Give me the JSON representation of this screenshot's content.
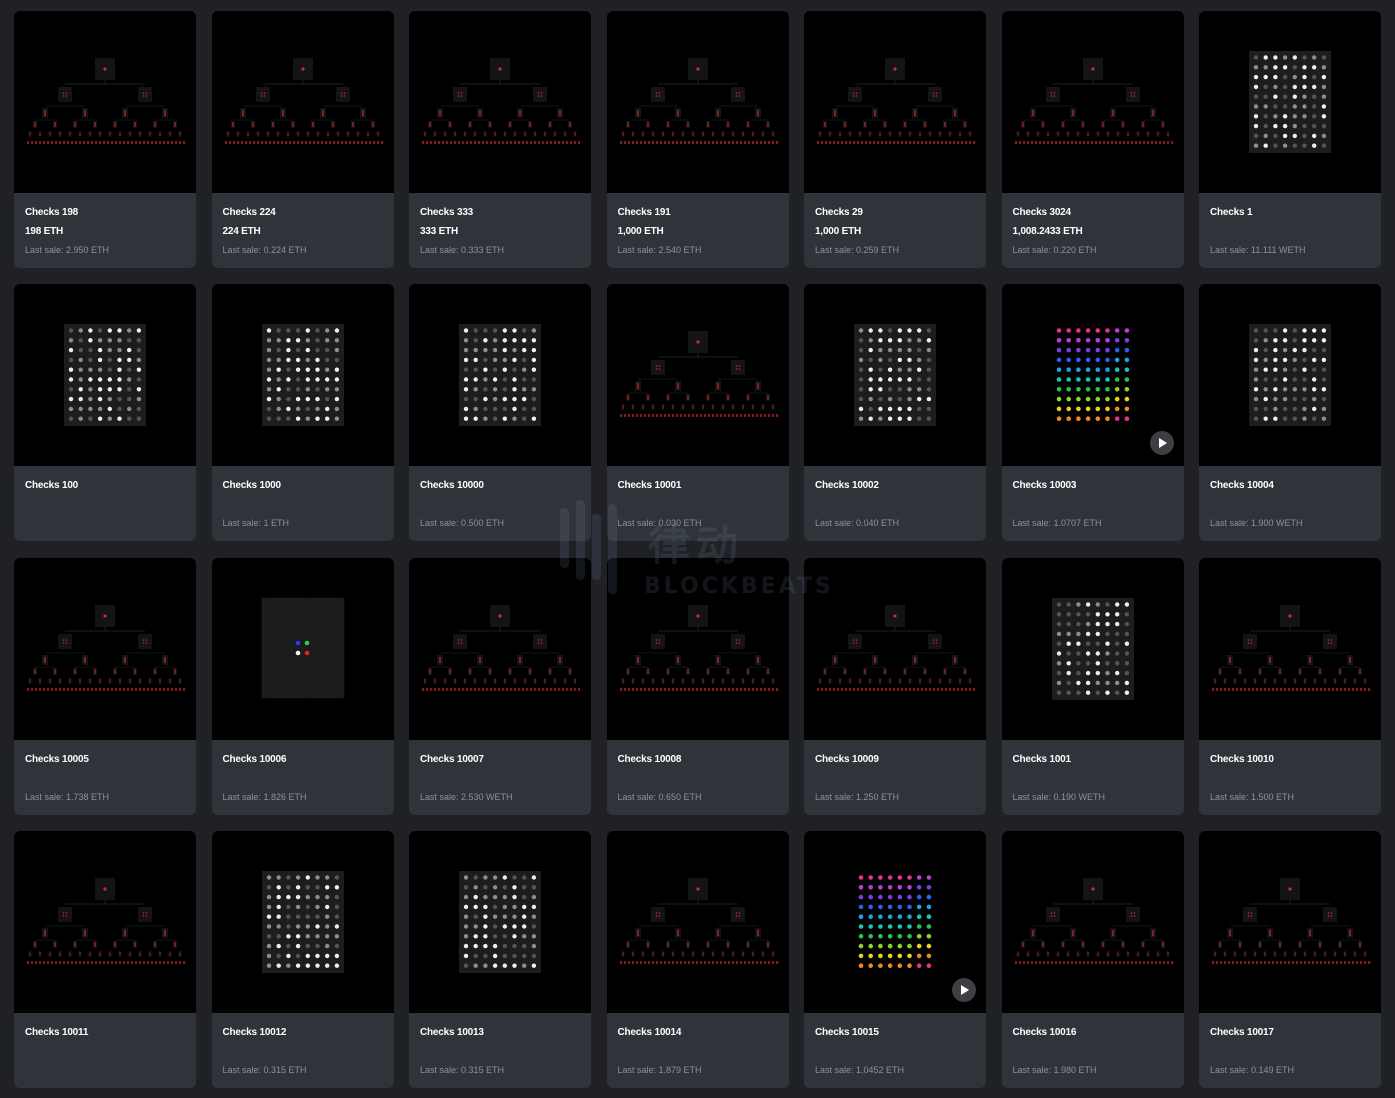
{
  "cards": [
    {
      "name": "Checks 198",
      "price": "198 ETH",
      "last_sale": "Last sale: 2.950 ETH",
      "art": "tree"
    },
    {
      "name": "Checks 224",
      "price": "224 ETH",
      "last_sale": "Last sale: 0.224 ETH",
      "art": "tree"
    },
    {
      "name": "Checks 333",
      "price": "333 ETH",
      "last_sale": "Last sale: 0.333 ETH",
      "art": "tree"
    },
    {
      "name": "Checks 191",
      "price": "1,000 ETH",
      "last_sale": "Last sale: 2.540 ETH",
      "art": "tree"
    },
    {
      "name": "Checks 29",
      "price": "1,000 ETH",
      "last_sale": "Last sale: 0.259 ETH",
      "art": "tree"
    },
    {
      "name": "Checks 3024",
      "price": "1,008.2433 ETH",
      "last_sale": "Last sale: 0.220 ETH",
      "art": "tree"
    },
    {
      "name": "Checks 1",
      "price": "",
      "last_sale": "Last sale: 11.111 WETH",
      "art": "grid"
    },
    {
      "name": "Checks 100",
      "price": "",
      "last_sale": "",
      "art": "grid"
    },
    {
      "name": "Checks 1000",
      "price": "",
      "last_sale": "Last sale: 1 ETH",
      "art": "grid"
    },
    {
      "name": "Checks 10000",
      "price": "",
      "last_sale": "Last sale: 0.500 ETH",
      "art": "grid"
    },
    {
      "name": "Checks 10001",
      "price": "",
      "last_sale": "Last sale: 0.030 ETH",
      "art": "tree"
    },
    {
      "name": "Checks 10002",
      "price": "",
      "last_sale": "Last sale: 0.040 ETH",
      "art": "grid"
    },
    {
      "name": "Checks 10003",
      "price": "",
      "last_sale": "Last sale: 1.0707 ETH",
      "art": "rainbow",
      "play": true
    },
    {
      "name": "Checks 10004",
      "price": "",
      "last_sale": "Last sale: 1.900 WETH",
      "art": "grid"
    },
    {
      "name": "Checks 10005",
      "price": "",
      "last_sale": "Last sale: 1.738 ETH",
      "art": "tree"
    },
    {
      "name": "Checks 10006",
      "price": "",
      "last_sale": "Last sale: 1.826 ETH",
      "art": "four"
    },
    {
      "name": "Checks 10007",
      "price": "",
      "last_sale": "Last sale: 2.530 WETH",
      "art": "tree"
    },
    {
      "name": "Checks 10008",
      "price": "",
      "last_sale": "Last sale: 0.650 ETH",
      "art": "tree"
    },
    {
      "name": "Checks 10009",
      "price": "",
      "last_sale": "Last sale: 1.250 ETH",
      "art": "tree"
    },
    {
      "name": "Checks 1001",
      "price": "",
      "last_sale": "Last sale: 0.190 WETH",
      "art": "grid"
    },
    {
      "name": "Checks 10010",
      "price": "",
      "last_sale": "Last sale: 1.500 ETH",
      "art": "tree"
    },
    {
      "name": "Checks 10011",
      "price": "",
      "last_sale": "",
      "art": "tree"
    },
    {
      "name": "Checks 10012",
      "price": "",
      "last_sale": "Last sale: 0.315 ETH",
      "art": "grid"
    },
    {
      "name": "Checks 10013",
      "price": "",
      "last_sale": "Last sale: 0.315 ETH",
      "art": "grid"
    },
    {
      "name": "Checks 10014",
      "price": "",
      "last_sale": "Last sale: 1.879 ETH",
      "art": "tree"
    },
    {
      "name": "Checks 10015",
      "price": "",
      "last_sale": "Last sale: 1.0452 ETH",
      "art": "rainbow",
      "play": true
    },
    {
      "name": "Checks 10016",
      "price": "",
      "last_sale": "Last sale: 1.980 ETH",
      "art": "tree"
    },
    {
      "name": "Checks 10017",
      "price": "",
      "last_sale": "Last sale: 0.149 ETH",
      "art": "tree"
    }
  ],
  "watermark": {
    "cn": "律动",
    "en": "BLOCKBEATS"
  },
  "colors": {
    "background": "#202125",
    "card": "#303339",
    "artwork": "#000000",
    "sale_text": "#8a939b",
    "tree_red": "#d02a2a",
    "rainbow": [
      "#e8308f",
      "#c03ad8",
      "#7a3ee8",
      "#2f5ff0",
      "#1aa4e6",
      "#12c9b8",
      "#23c84a",
      "#8ed624",
      "#f1d21a",
      "#f08a1c"
    ]
  },
  "icons": {
    "play": "play-icon"
  }
}
